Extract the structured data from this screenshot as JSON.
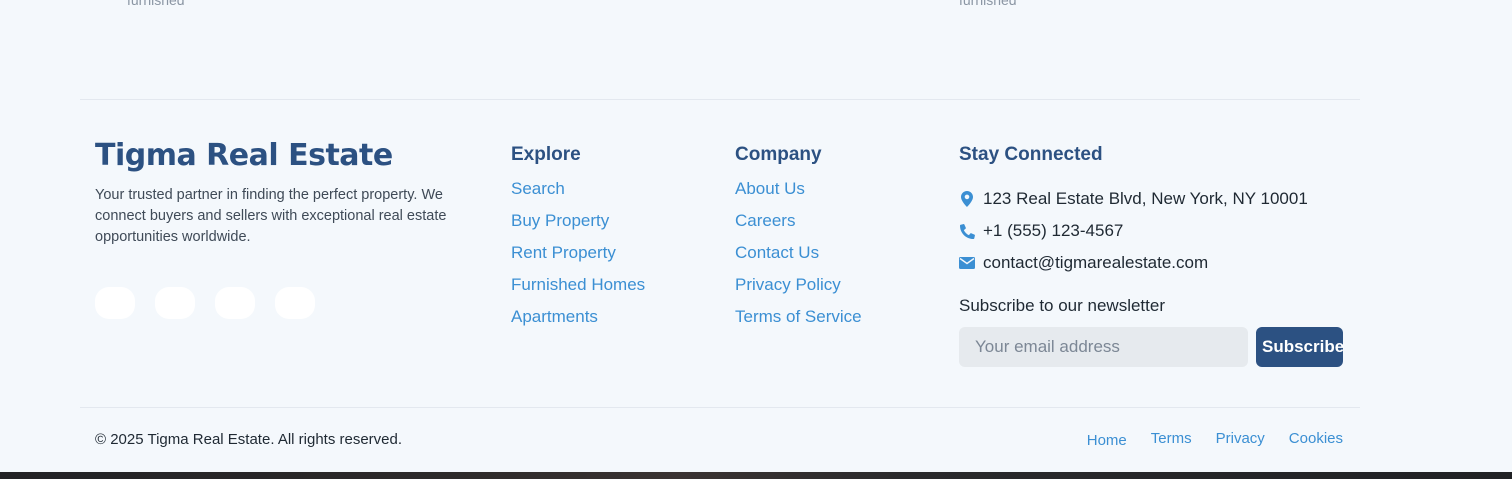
{
  "top_fragments": {
    "left": "furnished",
    "right": "furnished"
  },
  "brand": {
    "name": "Tigma Real Estate",
    "description": "Your trusted partner in finding the perfect property. We connect buyers and sellers with exceptional real estate opportunities worldwide.",
    "socials": [
      "social-link-1",
      "social-link-2",
      "social-link-3",
      "social-link-4"
    ]
  },
  "explore": {
    "title": "Explore",
    "links": [
      "Search",
      "Buy Property",
      "Rent Property",
      "Furnished Homes",
      "Apartments"
    ]
  },
  "company": {
    "title": "Company",
    "links": [
      "About Us",
      "Careers",
      "Contact Us",
      "Privacy Policy",
      "Terms of Service"
    ]
  },
  "connect": {
    "title": "Stay Connected",
    "address": "123 Real Estate Blvd, New York, NY 10001",
    "phone": "+1 (555) 123-4567",
    "email": "contact@tigmarealestate.com",
    "icons": {
      "address": "map-pin-icon",
      "phone": "phone-icon",
      "email": "envelope-icon"
    },
    "newsletter_label": "Subscribe to our newsletter",
    "email_placeholder": "Your email address",
    "subscribe_label": "Subscribe"
  },
  "bottom": {
    "copyright": "© 2025 Tigma Real Estate. All rights reserved.",
    "links": [
      "Home",
      "Terms",
      "Privacy",
      "Cookies"
    ]
  },
  "colors": {
    "primary": "#2c5182",
    "link": "#3b8fd3",
    "background": "#f4f8fc"
  }
}
